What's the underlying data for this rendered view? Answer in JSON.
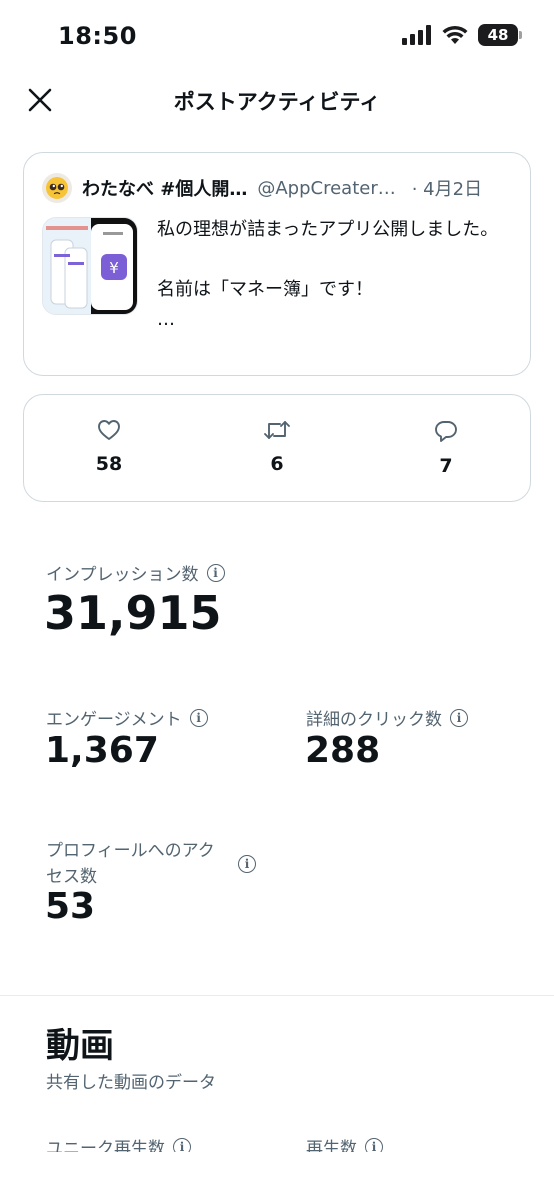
{
  "status_bar": {
    "time": "18:50",
    "battery": "48"
  },
  "header": {
    "title": "ポストアクティビティ"
  },
  "post": {
    "author_name": "わたなべ #個人開…",
    "handle": "@AppCreater…",
    "date": "· 4月2日",
    "text": "私の理想が詰まったアプリ公開しました。\n\n名前は「マネー簿」です！\n…"
  },
  "engagement": {
    "likes": "58",
    "reposts": "6",
    "replies": "7"
  },
  "stats": {
    "impressions_label": "インプレッション数",
    "impressions_value": "31,915",
    "engagements_label": "エンゲージメント",
    "engagements_value": "1,367",
    "detail_clicks_label": "詳細のクリック数",
    "detail_clicks_value": "288",
    "profile_visits_label": "プロフィールへのアク\nセス数",
    "profile_visits_value": "53"
  },
  "video": {
    "title": "動画",
    "subtitle": "共有した動画のデータ",
    "unique_plays_label": "ユニーク再生数",
    "plays_label": "再生数"
  },
  "colors": {
    "text": "#0f1419",
    "secondary": "#536471",
    "border": "#cfd9de"
  },
  "icons": [
    "close-icon",
    "heart-icon",
    "repost-icon",
    "reply-icon",
    "info-icon",
    "signal-icon",
    "wifi-icon",
    "battery-icon"
  ]
}
